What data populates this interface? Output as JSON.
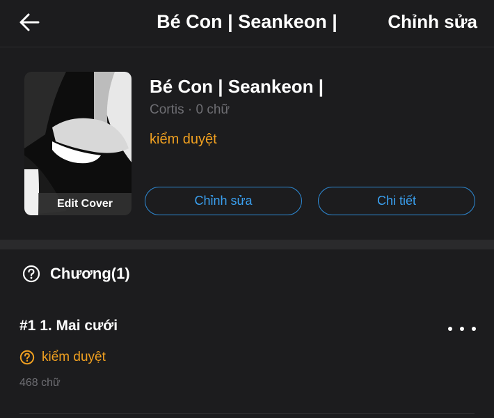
{
  "topbar": {
    "back_icon": "arrow-left-icon",
    "title": "Bé Con | Seankeon |",
    "edit_label": "Chỉnh sửa"
  },
  "story": {
    "cover_label": "Edit Cover",
    "title": "Bé Con | Seankeon |",
    "meta": "Cortis · 0 chữ",
    "status": "kiểm duyệt",
    "edit_button": "Chỉnh sửa",
    "detail_button": "Chi tiết"
  },
  "chapters": {
    "header_icon": "question-circle-icon",
    "header": "Chương(1)",
    "items": [
      {
        "title": "#1 1. Mai cưới",
        "status_icon": "question-circle-icon",
        "status": "kiểm duyệt",
        "words": "468 chữ"
      }
    ]
  },
  "colors": {
    "background": "#1c1c1e",
    "accent_blue": "#3aa0f0",
    "status_orange": "#f0a020",
    "muted_text": "#6e6e73"
  }
}
